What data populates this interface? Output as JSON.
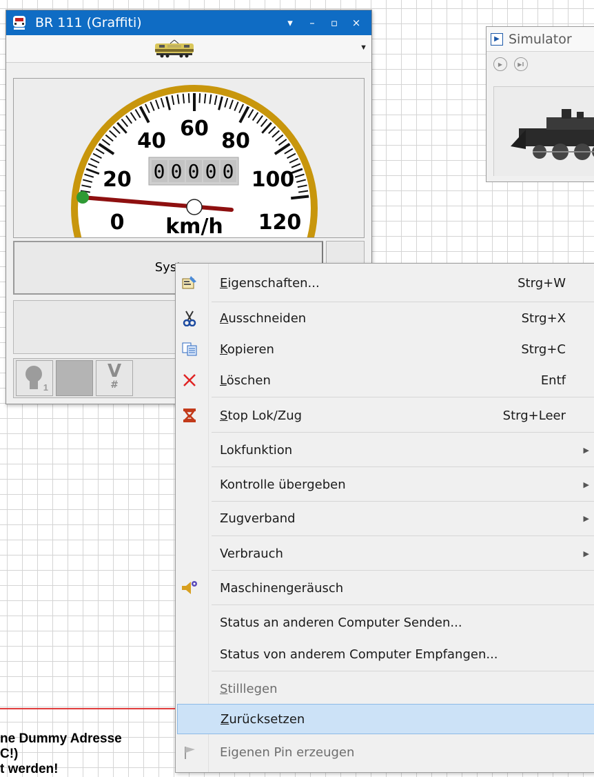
{
  "loco_window": {
    "title": "BR 111 (Graffiti)",
    "title_buttons": [
      "▾",
      "–",
      "▫",
      "×"
    ],
    "speedometer": {
      "scale_labels": [
        "0",
        "20",
        "40",
        "60",
        "80",
        "100",
        "120"
      ],
      "unit": "km/h",
      "odometer": [
        "0",
        "0",
        "0",
        "0",
        "0"
      ],
      "max_speed": 120,
      "current_speed": 0,
      "needle_color": "#8e1010",
      "ring_color": "#c8960c"
    },
    "system_button_label": "Syst",
    "function_buttons": [
      {
        "icon": "lightbulb-icon",
        "number": "1"
      },
      {
        "icon": "gray-square-icon"
      },
      {
        "icon": "v-hash-icon",
        "label_top": "V",
        "label_bottom": "#"
      }
    ]
  },
  "simulator": {
    "title": "Simulator",
    "controls": [
      "play-icon",
      "pause-step-icon"
    ]
  },
  "bottom_text": [
    "ne Dummy Adresse",
    "C!)",
    "t werden!"
  ],
  "context_menu": {
    "items": [
      {
        "icon": "properties-icon",
        "pre": "",
        "accel": "E",
        "post": "igenschaften...",
        "shortcut": "Strg+W",
        "submenu": false,
        "disabled": false
      },
      {
        "icon": "scissors-icon",
        "pre": "",
        "accel": "A",
        "post": "usschneiden",
        "shortcut": "Strg+X",
        "submenu": false,
        "disabled": false
      },
      {
        "icon": "copy-icon",
        "pre": "",
        "accel": "K",
        "post": "opieren",
        "shortcut": "Strg+C",
        "submenu": false,
        "disabled": false
      },
      {
        "icon": "delete-icon",
        "pre": "",
        "accel": "L",
        "post": "öschen",
        "shortcut": "Entf",
        "submenu": false,
        "disabled": false
      },
      {
        "icon": "stop-icon",
        "pre": "",
        "accel": "S",
        "post": "top Lok/Zug",
        "shortcut": "Strg+Leer",
        "submenu": false,
        "disabled": false
      },
      {
        "icon": "",
        "pre": "Lokfunktion",
        "accel": "",
        "post": "",
        "shortcut": "",
        "submenu": true,
        "disabled": false
      },
      {
        "icon": "",
        "pre": "Kontrolle übergeben",
        "accel": "",
        "post": "",
        "shortcut": "",
        "submenu": true,
        "disabled": false
      },
      {
        "icon": "",
        "pre": "Zugverband",
        "accel": "",
        "post": "",
        "shortcut": "",
        "submenu": true,
        "disabled": false
      },
      {
        "icon": "",
        "pre": "Verbrauch",
        "accel": "",
        "post": "",
        "shortcut": "",
        "submenu": true,
        "disabled": false
      },
      {
        "icon": "engine-sound-icon",
        "pre": "Maschinengeräusch",
        "accel": "",
        "post": "",
        "shortcut": "",
        "submenu": false,
        "disabled": false
      },
      {
        "icon": "",
        "pre": "Status an anderen Computer Senden...",
        "accel": "",
        "post": "",
        "shortcut": "",
        "submenu": false,
        "disabled": false
      },
      {
        "icon": "",
        "pre": "Status von anderem Computer Empfangen...",
        "accel": "",
        "post": "",
        "shortcut": "",
        "submenu": false,
        "disabled": false
      },
      {
        "icon": "",
        "pre": "",
        "accel": "S",
        "post": "tilllegen",
        "shortcut": "",
        "submenu": false,
        "disabled": true
      },
      {
        "icon": "",
        "pre": "",
        "accel": "Z",
        "post": "urücksetzen",
        "shortcut": "",
        "submenu": false,
        "disabled": false,
        "highlighted": true
      },
      {
        "icon": "pin-icon",
        "pre": "Eigenen Pin erzeugen",
        "accel": "",
        "post": "",
        "shortcut": "",
        "submenu": false,
        "disabled": true
      }
    ]
  }
}
